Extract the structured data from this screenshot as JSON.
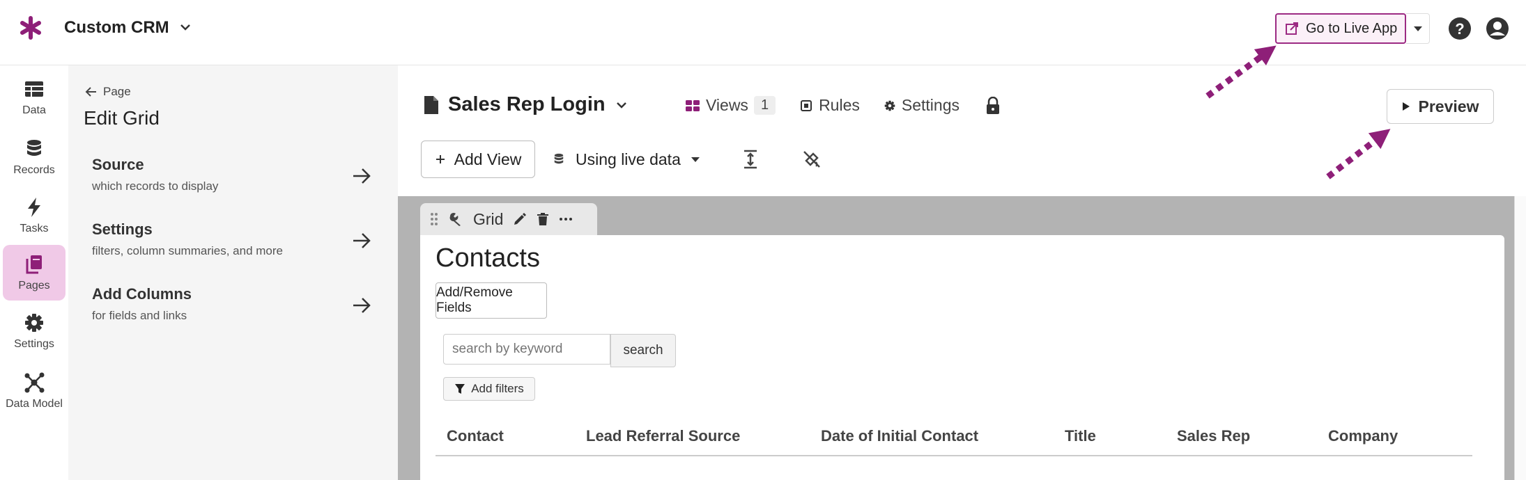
{
  "app": {
    "name": "Custom CRM"
  },
  "topbar": {
    "live_app_label": "Go to Live App"
  },
  "nav": {
    "items": [
      {
        "label": "Data",
        "icon": "table-icon",
        "active": false
      },
      {
        "label": "Records",
        "icon": "database-icon",
        "active": false
      },
      {
        "label": "Tasks",
        "icon": "bolt-icon",
        "active": false
      },
      {
        "label": "Pages",
        "icon": "pages-icon",
        "active": true
      },
      {
        "label": "Settings",
        "icon": "gear-icon",
        "active": false
      },
      {
        "label": "Data Model",
        "icon": "network-icon",
        "active": false
      }
    ]
  },
  "panel": {
    "back_label": "Page",
    "title": "Edit Grid",
    "items": [
      {
        "title": "Source",
        "subtitle": "which records to display"
      },
      {
        "title": "Settings",
        "subtitle": "filters, column summaries, and more"
      },
      {
        "title": "Add Columns",
        "subtitle": "for fields and links"
      }
    ]
  },
  "main": {
    "page_title": "Sales Rep Login",
    "views_label": "Views",
    "views_count": "1",
    "rules_label": "Rules",
    "settings_label": "Settings",
    "preview_label": "Preview",
    "add_view_label": "Add View",
    "live_data_label": "Using live data"
  },
  "grid": {
    "tab_label": "Grid",
    "title": "Contacts",
    "fields_button": "Add/Remove Fields",
    "search_placeholder": "search by keyword",
    "search_button": "search",
    "filters_button": "Add filters",
    "columns": [
      "Contact",
      "Lead Referral Source",
      "Date of Initial Contact",
      "Title",
      "Sales Rep",
      "Company"
    ]
  },
  "colors": {
    "brand": "#8e1f78",
    "annotation_arrow": "#8e1f78"
  }
}
